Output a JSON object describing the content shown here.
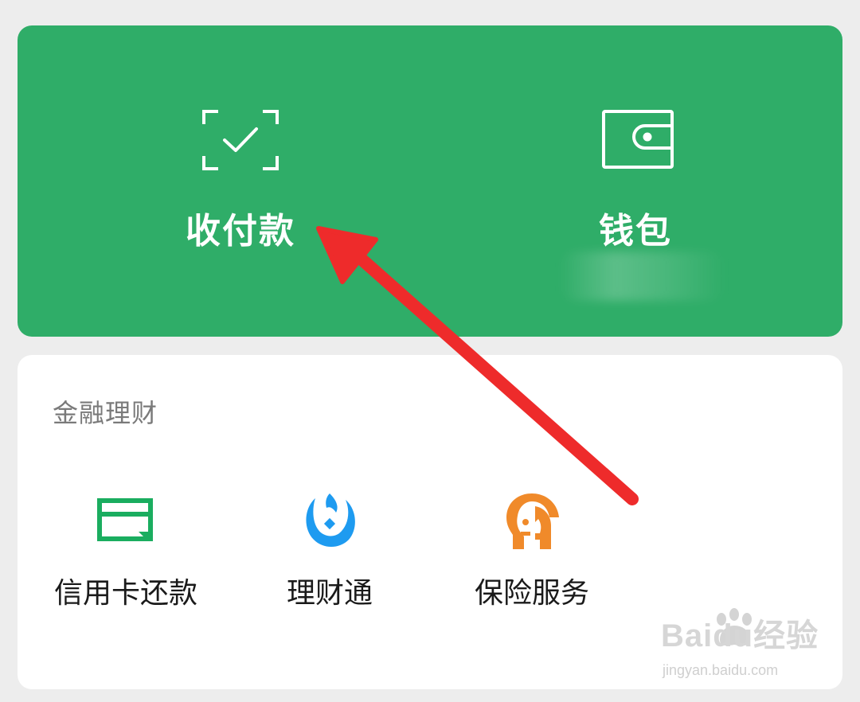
{
  "top_panel": {
    "pay": {
      "label": "收付款",
      "icon": "scan-check-icon"
    },
    "wallet": {
      "label": "钱包",
      "icon": "wallet-icon"
    }
  },
  "finance_section": {
    "title": "金融理财",
    "items": [
      {
        "label": "信用卡还款",
        "icon": "credit-card-icon",
        "color": "#1aad5f"
      },
      {
        "label": "理财通",
        "icon": "licaitong-icon",
        "color": "#1e9bf0"
      },
      {
        "label": "保险服务",
        "icon": "insurance-icon",
        "color": "#f08a2a"
      }
    ]
  },
  "watermark": {
    "brand": "Baidu经验",
    "url": "jingyan.baidu.com"
  },
  "colors": {
    "green": "#2fad68",
    "background": "#ededed",
    "arrow": "#ee2b2b"
  }
}
